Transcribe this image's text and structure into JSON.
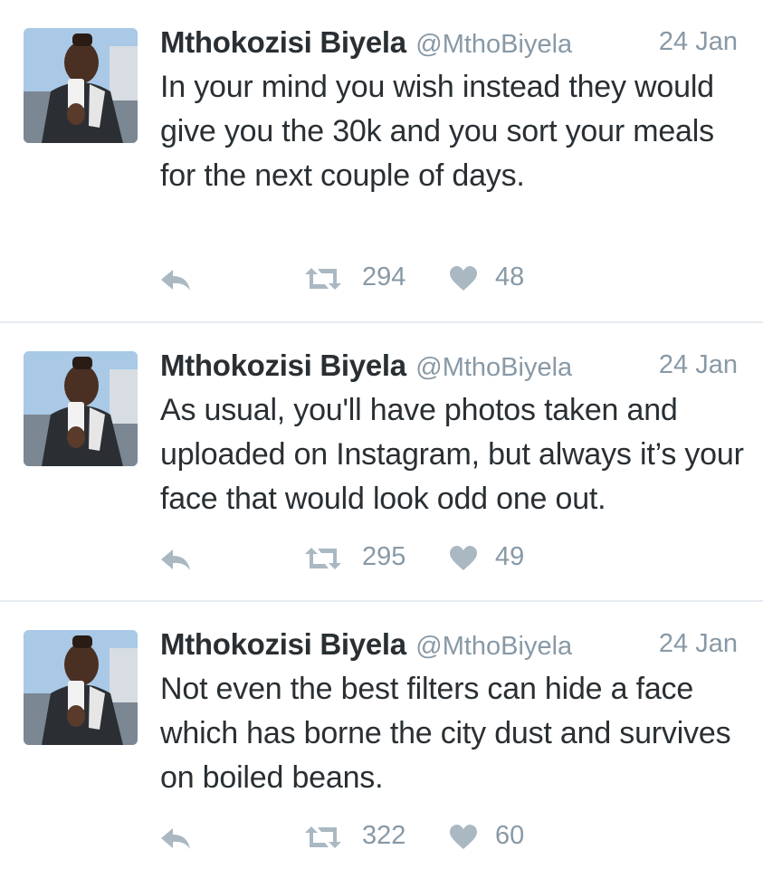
{
  "colors": {
    "text": "#292f33",
    "muted": "#8899a6",
    "icon": "#aab8c2",
    "divider": "#e6ecf0"
  },
  "tweets": [
    {
      "name": "Mthokozisi Biyela",
      "handle": "@MthoBiyela",
      "date": "24 Jan",
      "text": "In your mind you wish instead they would give you the 30k and you sort your meals for the next couple of days.",
      "retweets": "294",
      "likes": "48"
    },
    {
      "name": "Mthokozisi Biyela",
      "handle": "@MthoBiyela",
      "date": "24 Jan",
      "text": "As usual, you'll have photos taken and uploaded on Instagram, but always it’s your face that would look odd one out.",
      "retweets": "295",
      "likes": "49"
    },
    {
      "name": "Mthokozisi Biyela",
      "handle": "@MthoBiyela",
      "date": "24 Jan",
      "text": "Not even the best filters can hide a face which has borne the city dust and survives on boiled beans.",
      "retweets": "322",
      "likes": "60"
    }
  ],
  "icons": {
    "reply": "reply-icon",
    "retweet": "retweet-icon",
    "like": "heart-icon"
  }
}
